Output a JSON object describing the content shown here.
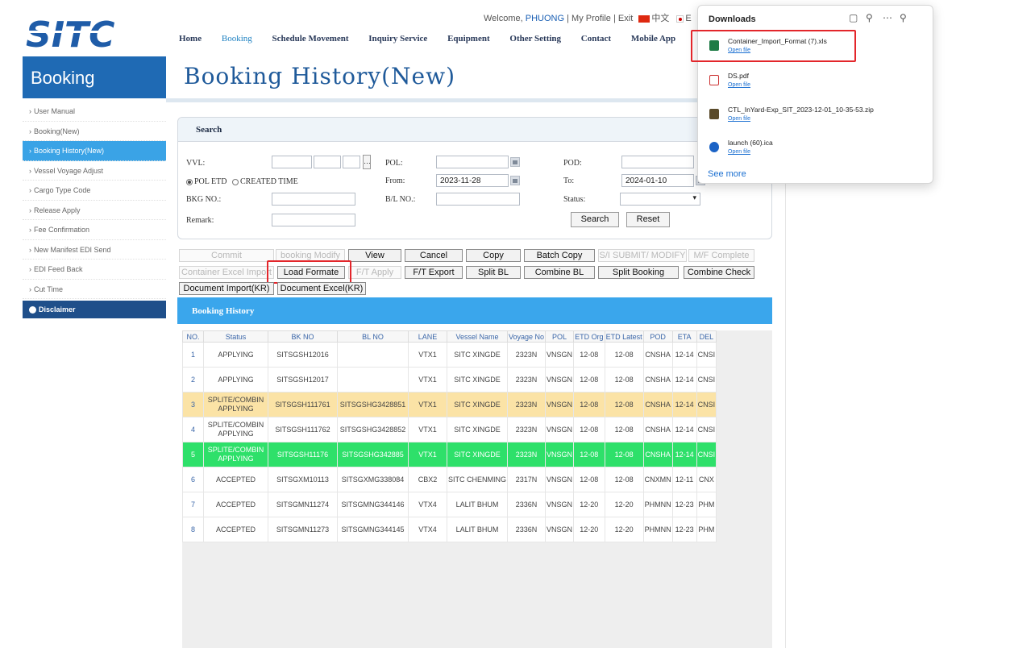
{
  "header": {
    "logo_text": "SITC",
    "welcome": "Welcome,",
    "user": "PHUONG",
    "my_profile": "My Profile",
    "exit": "Exit",
    "lang_cn": "中文",
    "lang_jp": "E",
    "nav": [
      "Home",
      "Booking",
      "Schedule Movement",
      "Inquiry Service",
      "Equipment",
      "Other Setting",
      "Contact",
      "Mobile App"
    ],
    "active_nav": "Booking"
  },
  "sidebar": {
    "title": "Booking",
    "items": [
      {
        "label": "User Manual"
      },
      {
        "label": "Booking(New)"
      },
      {
        "label": "Booking History(New)",
        "active": true
      },
      {
        "label": "Vessel Voyage Adjust"
      },
      {
        "label": "Cargo Type Code"
      },
      {
        "label": "Release Apply"
      },
      {
        "label": "Fee Confirmation"
      },
      {
        "label": "New Manifest EDI Send"
      },
      {
        "label": "EDI Feed Back"
      },
      {
        "label": "Cut Time"
      }
    ],
    "disclaimer": "Disclaimer"
  },
  "page_title": "Booking History(New)",
  "search": {
    "title": "Search",
    "vvl_label": "VVL:",
    "pol_label": "POL:",
    "pod_label": "POD:",
    "radio_pol_etd": "POL ETD",
    "radio_created": "CREATED TIME",
    "from_label": "From:",
    "from_value": "2023-11-28",
    "to_label": "To:",
    "to_value": "2024-01-10",
    "bkg_no_label": "BKG NO.:",
    "bl_no_label": "B/L NO.:",
    "status_label": "Status:",
    "remark_label": "Remark:",
    "search_button": "Search",
    "reset_button": "Reset"
  },
  "actions": {
    "row1": [
      "Commit",
      "booking Modify",
      "View",
      "Cancel",
      "Copy",
      "Batch Copy",
      "S/I SUBMIT/ MODIFY",
      "M/F Complete"
    ],
    "row2": [
      "Container Excel Import",
      "Load Formate",
      "F/T Apply",
      "F/T Export",
      "Split BL",
      "Combine BL",
      "Split Booking",
      "Combine Check"
    ],
    "row3": [
      "Document Import(KR)",
      "Document Excel(KR)"
    ]
  },
  "history": {
    "title": "Booking History",
    "columns": [
      "NO.",
      "Status",
      "BK NO",
      "BL NO",
      "LANE",
      "Vessel Name",
      "Voyage No",
      "POL",
      "ETD Org",
      "ETD Latest",
      "POD",
      "ETA",
      "DEL"
    ],
    "rows": [
      {
        "no": "1",
        "status": "APPLYING",
        "status2": "",
        "bk": "SITSGSH12016",
        "bl": "",
        "lane": "VTX1",
        "vessel": "SITC XINGDE",
        "voyage": "2323N",
        "pol": "VNSGN",
        "etd_org": "12-08",
        "etd_latest": "12-08",
        "pod": "CNSHA",
        "eta": "12-14",
        "del": "CNSI",
        "style": ""
      },
      {
        "no": "2",
        "status": "APPLYING",
        "status2": "",
        "bk": "SITSGSH12017",
        "bl": "",
        "lane": "VTX1",
        "vessel": "SITC XINGDE",
        "voyage": "2323N",
        "pol": "VNSGN",
        "etd_org": "12-08",
        "etd_latest": "12-08",
        "pod": "CNSHA",
        "eta": "12-14",
        "del": "CNSI",
        "style": ""
      },
      {
        "no": "3",
        "status": "SPLITE/COMBIN",
        "status2": "APPLYING",
        "bk": "SITSGSH111761",
        "bl": "SITSGSHG3428851",
        "lane": "VTX1",
        "vessel": "SITC XINGDE",
        "voyage": "2323N",
        "pol": "VNSGN",
        "etd_org": "12-08",
        "etd_latest": "12-08",
        "pod": "CNSHA",
        "eta": "12-14",
        "del": "CNSI",
        "style": "yellow"
      },
      {
        "no": "4",
        "status": "SPLITE/COMBIN",
        "status2": "APPLYING",
        "bk": "SITSGSH111762",
        "bl": "SITSGSHG3428852",
        "lane": "VTX1",
        "vessel": "SITC XINGDE",
        "voyage": "2323N",
        "pol": "VNSGN",
        "etd_org": "12-08",
        "etd_latest": "12-08",
        "pod": "CNSHA",
        "eta": "12-14",
        "del": "CNSI",
        "style": ""
      },
      {
        "no": "5",
        "status": "SPLITE/COMBIN",
        "status2": "APPLYING",
        "bk": "SITSGSH11176",
        "bl": "SITSGSHG342885",
        "lane": "VTX1",
        "vessel": "SITC XINGDE",
        "voyage": "2323N",
        "pol": "VNSGN",
        "etd_org": "12-08",
        "etd_latest": "12-08",
        "pod": "CNSHA",
        "eta": "12-14",
        "del": "CNSI",
        "style": "green"
      },
      {
        "no": "6",
        "status": "ACCEPTED",
        "status2": "",
        "bk": "SITSGXM10113",
        "bl": "SITSGXMG338084",
        "lane": "CBX2",
        "vessel": "SITC CHENMING",
        "voyage": "2317N",
        "pol": "VNSGN",
        "etd_org": "12-08",
        "etd_latest": "12-08",
        "pod": "CNXMN",
        "eta": "12-11",
        "del": "CNX",
        "style": ""
      },
      {
        "no": "7",
        "status": "ACCEPTED",
        "status2": "",
        "bk": "SITSGMN11274",
        "bl": "SITSGMNG344146",
        "lane": "VTX4",
        "vessel": "LALIT BHUM",
        "voyage": "2336N",
        "pol": "VNSGN",
        "etd_org": "12-20",
        "etd_latest": "12-20",
        "pod": "PHMNN",
        "eta": "12-23",
        "del": "PHM",
        "style": ""
      },
      {
        "no": "8",
        "status": "ACCEPTED",
        "status2": "",
        "bk": "SITSGMN11273",
        "bl": "SITSGMNG344145",
        "lane": "VTX4",
        "vessel": "LALIT BHUM",
        "voyage": "2336N",
        "pol": "VNSGN",
        "etd_org": "12-20",
        "etd_latest": "12-20",
        "pod": "PHMNN",
        "eta": "12-23",
        "del": "PHM",
        "style": ""
      }
    ]
  },
  "downloads": {
    "title": "Downloads",
    "items": [
      {
        "name": "Container_Import_Format (7).xls",
        "action": "Open file",
        "icon": "excel-file-icon",
        "highlighted": true
      },
      {
        "name": "DS.pdf",
        "action": "Open file",
        "icon": "pdf-file-icon"
      },
      {
        "name": "CTL_InYard-Exp_SIT_2023-12-01_10-35-53.zip",
        "action": "Open file",
        "icon": "zip-file-icon"
      },
      {
        "name": "launch (60).ica",
        "action": "Open file",
        "icon": "ica-file-icon"
      }
    ],
    "see_more": "See more"
  },
  "colors": {
    "brand_blue": "#1f6ab4",
    "active_blue": "#3aa3e6",
    "highlight_red": "#e3262b",
    "row_yellow": "#fbe3a6",
    "row_green": "#2ee06a"
  }
}
